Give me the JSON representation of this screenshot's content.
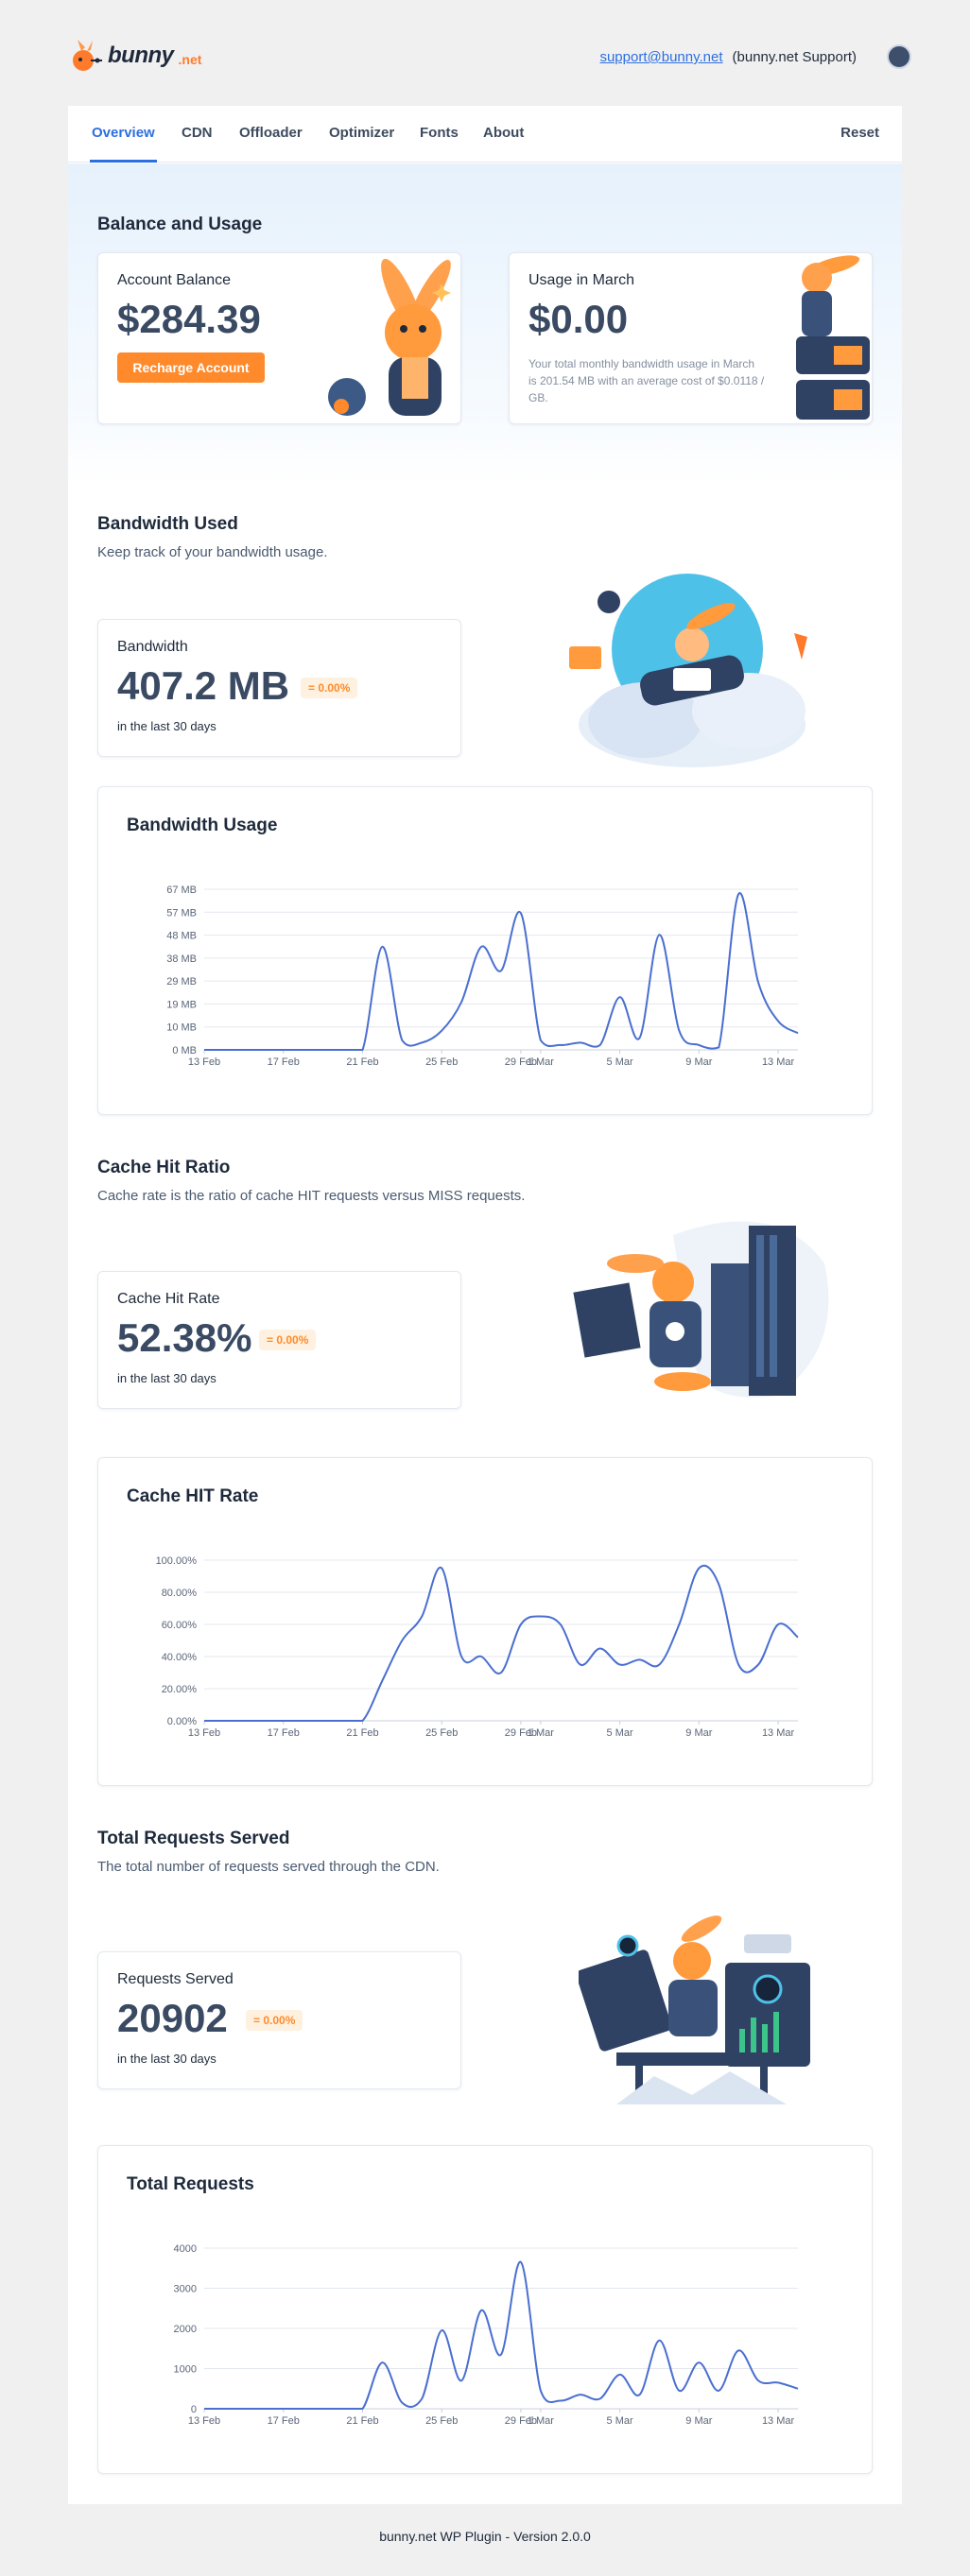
{
  "brand": {
    "name": "bunny",
    "tld": ".net"
  },
  "header": {
    "email": "support@bunny.net",
    "who": "(bunny.net Support)"
  },
  "tabs": [
    "Overview",
    "CDN",
    "Offloader",
    "Optimizer",
    "Fonts",
    "About"
  ],
  "reset": "Reset",
  "balance": {
    "title": "Balance and Usage",
    "account_label": "Account Balance",
    "account_value": "$284.39",
    "recharge": "Recharge Account",
    "usage_label": "Usage in March",
    "usage_value": "$0.00",
    "usage_desc": "Your total monthly bandwidth usage in March is 201.54 MB with an average cost of $0.0118 / GB."
  },
  "bandwidth": {
    "title": "Bandwidth Used",
    "subtitle": "Keep track of your bandwidth usage.",
    "label": "Bandwidth",
    "value": "407.2 MB",
    "change": "0.00%",
    "period": "in the last 30 days",
    "chart_title": "Bandwidth Usage"
  },
  "cache": {
    "title": "Cache Hit Ratio",
    "subtitle": "Cache rate is the ratio of cache HIT requests versus MISS requests.",
    "label": "Cache Hit Rate",
    "value": "52.38%",
    "change": "0.00%",
    "period": "in the last 30 days",
    "chart_title": "Cache HIT Rate"
  },
  "requests": {
    "title": "Total Requests Served",
    "subtitle": "The total number of requests served through the CDN.",
    "label": "Requests Served",
    "value": "20902",
    "change": "0.00%",
    "period": "in the last 30 days",
    "chart_title": "Total Requests"
  },
  "footer": "bunny.net WP Plugin - Version 2.0.0",
  "colors": {
    "accent": "#2d6fe0",
    "orange": "#ff8a2b",
    "line": "#4a6fd0"
  },
  "chart_data": [
    {
      "type": "line",
      "title": "Bandwidth Usage",
      "x": [
        "13 Feb",
        "14 Feb",
        "15 Feb",
        "16 Feb",
        "17 Feb",
        "18 Feb",
        "19 Feb",
        "20 Feb",
        "21 Feb",
        "22 Feb",
        "23 Feb",
        "24 Feb",
        "25 Feb",
        "26 Feb",
        "27 Feb",
        "28 Feb",
        "29 Feb",
        "1 Mar",
        "2 Mar",
        "3 Mar",
        "4 Mar",
        "5 Mar",
        "6 Mar",
        "7 Mar",
        "8 Mar",
        "9 Mar",
        "10 Mar",
        "11 Mar",
        "12 Mar",
        "13 Mar",
        "14 Mar"
      ],
      "x_ticks": [
        "13 Feb",
        "17 Feb",
        "21 Feb",
        "25 Feb",
        "29 Feb",
        "1 Mar",
        "5 Mar",
        "9 Mar",
        "13 Mar"
      ],
      "y_ticks": [
        "0 MB",
        "10 MB",
        "19 MB",
        "29 MB",
        "38 MB",
        "48 MB",
        "57 MB",
        "67 MB"
      ],
      "ylim": [
        0,
        67
      ],
      "values": [
        0,
        0,
        0,
        0,
        0,
        0,
        0,
        0,
        0,
        43,
        4,
        3,
        8,
        20,
        43,
        33,
        57,
        4,
        2,
        3,
        2,
        22,
        5,
        48,
        8,
        2,
        1,
        65,
        28,
        12,
        7
      ]
    },
    {
      "type": "line",
      "title": "Cache HIT Rate",
      "x_ticks": [
        "13 Feb",
        "17 Feb",
        "21 Feb",
        "25 Feb",
        "29 Feb",
        "1 Mar",
        "5 Mar",
        "9 Mar",
        "13 Mar"
      ],
      "y_ticks": [
        "0.00%",
        "20.00%",
        "40.00%",
        "60.00%",
        "80.00%",
        "100.00%"
      ],
      "ylim": [
        0,
        100
      ],
      "values": [
        0,
        0,
        0,
        0,
        0,
        0,
        0,
        0,
        0,
        25,
        50,
        65,
        95,
        40,
        40,
        30,
        60,
        65,
        60,
        35,
        45,
        35,
        38,
        35,
        60,
        95,
        85,
        35,
        35,
        60,
        52
      ]
    },
    {
      "type": "line",
      "title": "Total Requests",
      "x_ticks": [
        "13 Feb",
        "17 Feb",
        "21 Feb",
        "25 Feb",
        "29 Feb",
        "1 Mar",
        "5 Mar",
        "9 Mar",
        "13 Mar"
      ],
      "y_ticks": [
        "0",
        "1000",
        "2000",
        "3000",
        "4000"
      ],
      "ylim": [
        0,
        4000
      ],
      "values": [
        0,
        0,
        0,
        0,
        0,
        0,
        0,
        0,
        0,
        1150,
        150,
        250,
        1950,
        700,
        2450,
        1350,
        3650,
        450,
        200,
        350,
        250,
        850,
        350,
        1700,
        450,
        1150,
        450,
        1450,
        700,
        650,
        500
      ]
    }
  ]
}
